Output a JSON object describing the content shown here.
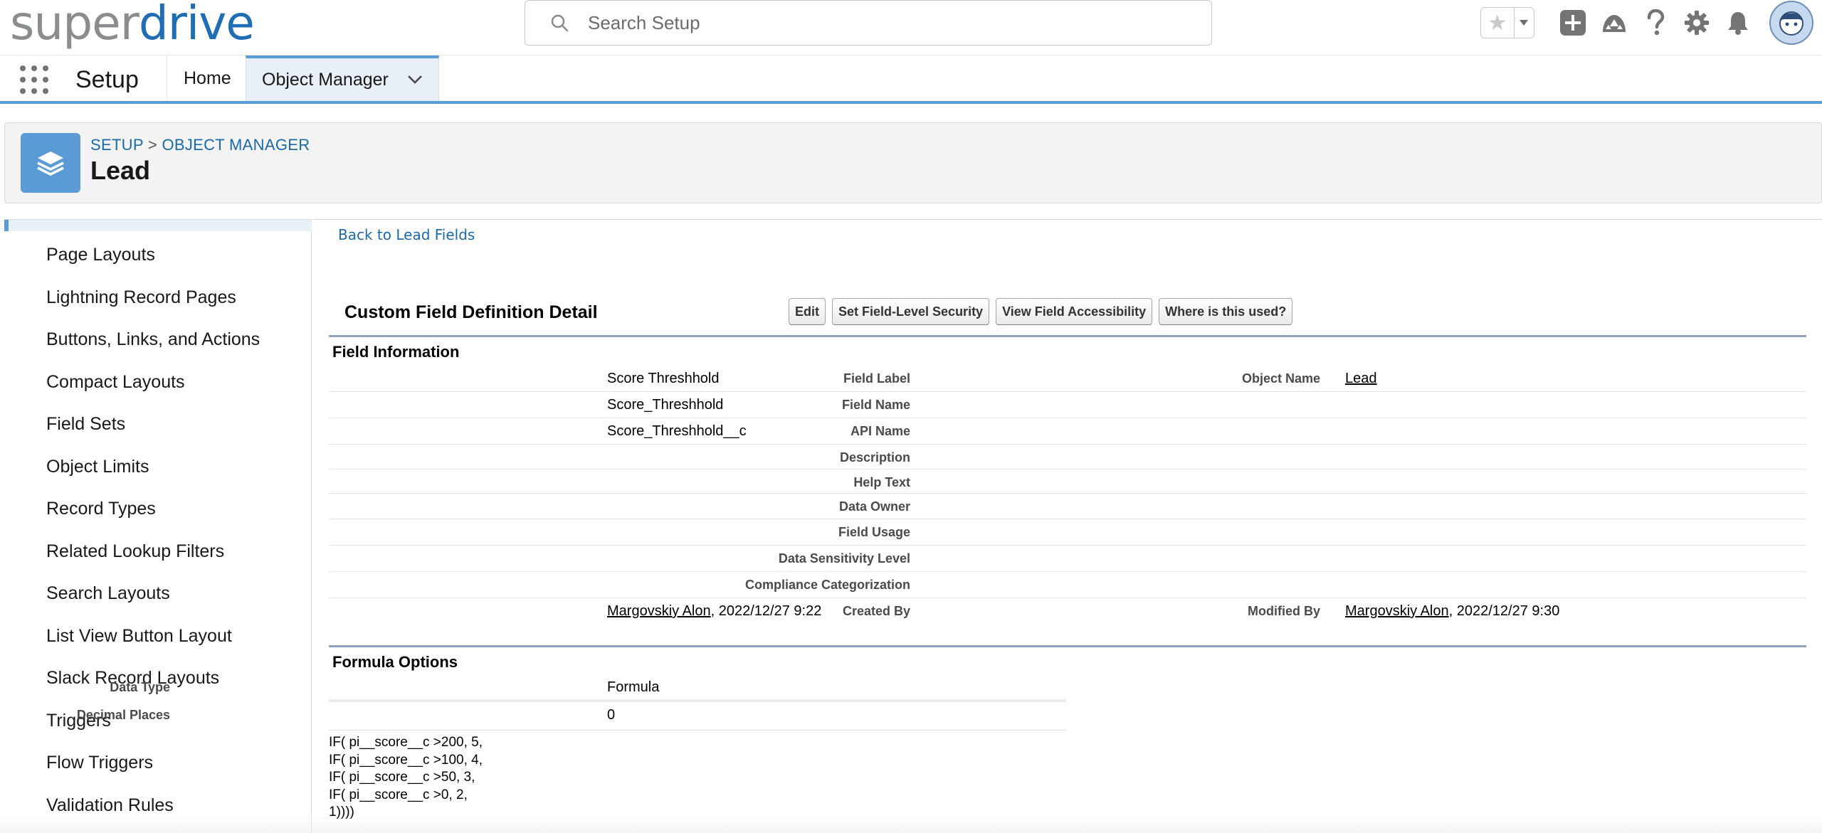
{
  "header": {
    "logo_part1": "super",
    "logo_part2": "drive",
    "search_placeholder": "Search Setup",
    "icons": [
      "search-icon",
      "star-icon",
      "chevron-down-icon",
      "add-icon",
      "trailhead-icon",
      "help-icon",
      "gear-icon",
      "bell-icon",
      "avatar"
    ]
  },
  "nav": {
    "app_name": "Setup",
    "tabs": [
      {
        "label": "Home"
      },
      {
        "label": "Object Manager"
      }
    ]
  },
  "object_header": {
    "breadcrumb_setup": "SETUP",
    "breadcrumb_sep": ">",
    "breadcrumb_object_manager": "OBJECT MANAGER",
    "title": "Lead"
  },
  "sidebar": {
    "items": [
      {
        "label": "Page Layouts"
      },
      {
        "label": "Lightning Record Pages"
      },
      {
        "label": "Buttons, Links, and Actions"
      },
      {
        "label": "Compact Layouts"
      },
      {
        "label": "Field Sets"
      },
      {
        "label": "Object Limits"
      },
      {
        "label": "Record Types"
      },
      {
        "label": "Related Lookup Filters"
      },
      {
        "label": "Search Layouts"
      },
      {
        "label": "List View Button Layout"
      },
      {
        "label": "Slack Record Layouts"
      },
      {
        "label": "Triggers"
      },
      {
        "label": "Flow Triggers"
      },
      {
        "label": "Validation Rules"
      }
    ]
  },
  "main": {
    "back_link": "Back to Lead Fields",
    "detail_title": "Custom Field Definition Detail",
    "buttons": {
      "edit": "Edit",
      "set_fls": "Set Field-Level Security",
      "view_access": "View Field Accessibility",
      "where_used": "Where is this used?"
    },
    "field_info": {
      "heading": "Field Information",
      "rows": [
        {
          "label": "Field Label",
          "value": "Score Threshhold"
        },
        {
          "label": "Field Name",
          "value": "Score_Threshhold"
        },
        {
          "label": "API Name",
          "value": "Score_Threshhold__c"
        },
        {
          "label": "Description",
          "value": ""
        },
        {
          "label": "Help Text",
          "value": ""
        },
        {
          "label": "Data Owner",
          "value": ""
        },
        {
          "label": "Field Usage",
          "value": ""
        },
        {
          "label": "Data Sensitivity Level",
          "value": ""
        },
        {
          "label": "Compliance Categorization",
          "value": ""
        },
        {
          "label": "Created By",
          "value": ""
        }
      ],
      "object_name_label": "Object Name",
      "object_name_value": "Lead",
      "created_by_user": "Margovskiy Alon",
      "created_by_date": ", 2022/12/27 9:22",
      "modified_by_label": "Modified By",
      "modified_by_user": "Margovskiy Alon",
      "modified_by_date": ", 2022/12/27 9:30"
    },
    "formula_options": {
      "heading": "Formula Options",
      "data_type_label": "Data Type",
      "data_type_value": "Formula",
      "decimal_places_label": "Decimal Places",
      "decimal_places_value": "0",
      "formula_text": "IF( pi__score__c >200, 5,\nIF( pi__score__c >100, 4,\nIF( pi__score__c >50, 3,\nIF( pi__score__c >0, 2,\n1))))"
    }
  }
}
